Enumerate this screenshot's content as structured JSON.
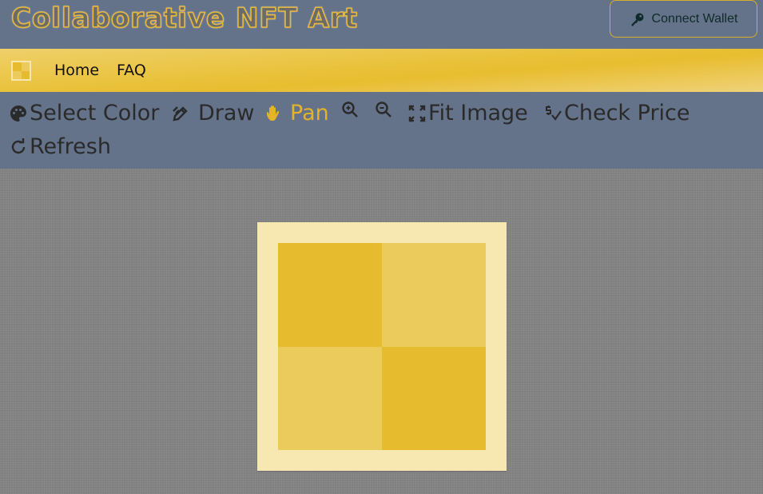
{
  "header": {
    "title": "Collaborative NFT Art",
    "connect_wallet_label": "Connect Wallet",
    "connect_wallet_icon": "key-icon"
  },
  "nav": {
    "logo_icon": "checker-logo-icon",
    "links": [
      {
        "label": "Home"
      },
      {
        "label": "FAQ"
      }
    ]
  },
  "toolbar": {
    "tools": [
      {
        "label": "Select Color",
        "icon": "palette-icon",
        "active": false
      },
      {
        "label": "Draw",
        "icon": "pencil-icon",
        "active": false
      },
      {
        "label": "Pan",
        "icon": "hand-icon",
        "active": true
      },
      {
        "label": "",
        "icon": "zoom-in-icon",
        "active": false
      },
      {
        "label": "",
        "icon": "zoom-out-icon",
        "active": false
      },
      {
        "label": "Fit Image",
        "icon": "expand-icon",
        "active": false
      },
      {
        "label": "Check Price",
        "icon": "dollar-check-icon",
        "active": false
      },
      {
        "label": "Refresh",
        "icon": "refresh-icon",
        "active": false
      }
    ]
  },
  "colors": {
    "accent": "#e5b32a",
    "header_bg": "#64738a",
    "canvas_bg": "#808080",
    "artwork_frame": "#f7e7b1"
  },
  "artwork": {
    "grid_size": [
      2,
      2
    ],
    "pixels": [
      [
        "#e7bb2e",
        "#eccb5d"
      ],
      [
        "#eccb5d",
        "#e7bb2e"
      ]
    ]
  }
}
